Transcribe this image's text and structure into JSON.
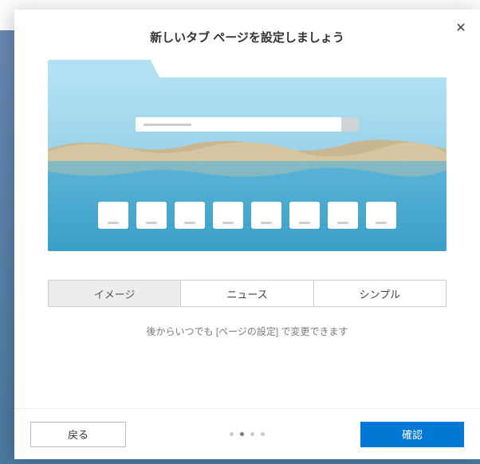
{
  "dialog": {
    "title": "新しいタブ ページを設定しましょう",
    "close_label": "✕"
  },
  "segments": {
    "image": "イメージ",
    "news": "ニュース",
    "simple": "シンプル"
  },
  "help_text": "後からいつでも [ページの設定] で変更できます",
  "footer": {
    "back": "戻る",
    "confirm": "確認"
  },
  "pager": {
    "count": 4,
    "active_index": 1
  },
  "preview": {
    "tile_count": 8
  }
}
